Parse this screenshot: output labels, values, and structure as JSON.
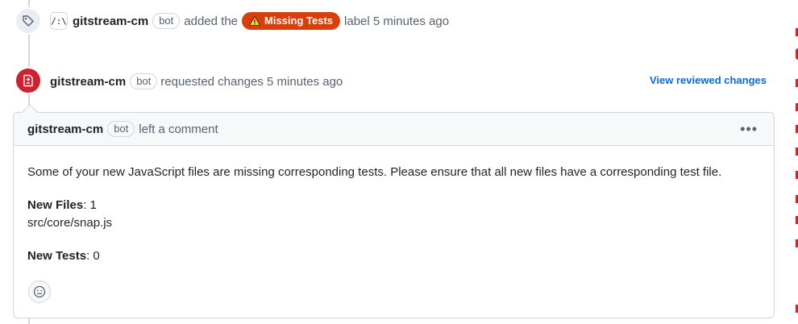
{
  "labeled_event": {
    "actor_avatar_text": "/:\\",
    "actor": "gitstream-cm",
    "bot_badge": "bot",
    "action_before": "added the",
    "label": {
      "text": "Missing Tests",
      "color": "#d93f0b",
      "icon": "warning-icon"
    },
    "action_after": "label 5 minutes ago",
    "icon": "tag-icon"
  },
  "review_event": {
    "icon": "file-diff-icon",
    "icon_color": "#cf222e",
    "actor": "gitstream-cm",
    "bot_badge": "bot",
    "action": "requested changes 5 minutes ago",
    "link": "View reviewed changes"
  },
  "comment": {
    "author": "gitstream-cm",
    "bot_badge": "bot",
    "action": "left a comment",
    "menu_icon": "kebab-horizontal-icon",
    "body": {
      "intro": "Some of your new JavaScript files are missing corresponding tests. Please ensure that all new files have a corresponding test file.",
      "new_files_label": "New Files",
      "new_files_value": ": 1",
      "file_path": "src/core/snap.js",
      "new_tests_label": "New Tests",
      "new_tests_value": ": 0"
    },
    "reaction_icon": "smiley-icon"
  },
  "colors": {
    "accent_link": "#0969da",
    "danger": "#cf222e",
    "label_orange": "#d93f0b",
    "border": "#d0d7de",
    "muted_text": "#59636e"
  }
}
